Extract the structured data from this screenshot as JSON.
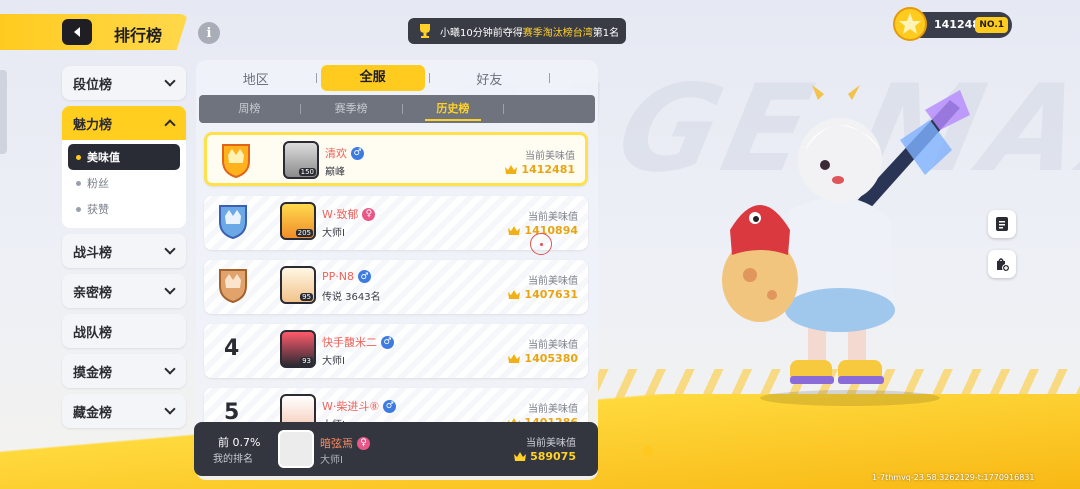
{
  "header": {
    "title": "排行榜"
  },
  "banner": {
    "prefix": "小曦10分钟前夺得",
    "highlight": "赛季淘汰榜台湾",
    "suffix": "第1名"
  },
  "score": {
    "value": "1412481",
    "rank": "NO.1"
  },
  "sidebar": {
    "items": [
      {
        "label": "段位榜"
      },
      {
        "label": "魅力榜",
        "subitems": [
          "美味值",
          "粉丝",
          "获赞"
        ]
      },
      {
        "label": "战斗榜"
      },
      {
        "label": "亲密榜"
      },
      {
        "label": "战队榜"
      },
      {
        "label": "摸金榜"
      },
      {
        "label": "藏金榜"
      }
    ]
  },
  "tabs": {
    "main": [
      "地区",
      "全服",
      "好友"
    ],
    "sub": [
      "周榜",
      "赛季榜",
      "历史榜"
    ]
  },
  "rows": [
    {
      "rank": "1",
      "name": "清欢",
      "gender": "male",
      "title": "巅峰",
      "level": "150",
      "value_label": "当前美味值",
      "value": "1412481"
    },
    {
      "rank": "2",
      "name": "W·致郁",
      "gender": "female",
      "title": "大师I",
      "level": "205",
      "value_label": "当前美味值",
      "value": "1410894"
    },
    {
      "rank": "3",
      "name": "PP·N8",
      "gender": "male",
      "title": "传说 3643名",
      "level": "95",
      "value_label": "当前美味值",
      "value": "1407631"
    },
    {
      "rank": "4",
      "name": "快手馥米二",
      "gender": "male",
      "title": "大师I",
      "level": "93",
      "value_label": "当前美味值",
      "value": "1405380"
    },
    {
      "rank": "5",
      "name": "W·柴进斗⑧",
      "gender": "male",
      "title": "大师I",
      "level": "",
      "value_label": "当前美味值",
      "value": "1401286"
    }
  ],
  "my_rank": {
    "percent": "前 0.7%",
    "label": "我的排名",
    "name": "暗弦焉",
    "gender": "female",
    "title": "大师I",
    "value_label": "当前美味值",
    "value": "589075"
  },
  "footer": {
    "id": "1-7thmvq-23.58.3262129-t:1770916831"
  }
}
